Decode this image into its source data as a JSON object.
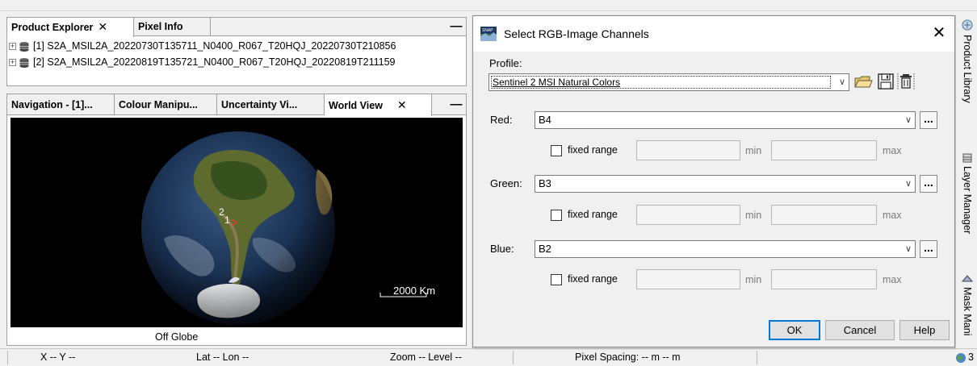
{
  "product_explorer": {
    "tabs": [
      {
        "label": "Product Explorer",
        "close": "✕"
      },
      {
        "label": "Pixel Info"
      }
    ],
    "minimize": "—",
    "products": [
      {
        "label": "[1] S2A_MSIL2A_20220730T135711_N0400_R067_T20HQJ_20220730T210856"
      },
      {
        "label": "[2] S2A_MSIL2A_20220819T135721_N0400_R067_T20HQJ_20220819T211159"
      }
    ]
  },
  "world_view_panel": {
    "tabs": [
      {
        "label": "Navigation - [1]..."
      },
      {
        "label": "Colour Manipu..."
      },
      {
        "label": "Uncertainty Vi..."
      },
      {
        "label": "World View",
        "close": "✕"
      }
    ],
    "minimize": "—",
    "markers": [
      "2",
      "1"
    ],
    "scale_label": "2000 Km",
    "off_globe": "Off Globe"
  },
  "status_bar": {
    "xy": "X   -- Y   --",
    "latlon": "Lat     -- Lon     --",
    "zoom": "Zoom -- Level --",
    "pixel_spacing": "Pixel Spacing: -- m -- m",
    "count": "3"
  },
  "dialog": {
    "title": "Select RGB-Image Channels",
    "close": "✕",
    "profile_label": "Profile:",
    "profile_value": "Sentinel 2 MSI Natural Colors",
    "channels": [
      {
        "label": "Red:",
        "value": "B4",
        "fixed_range": "fixed range",
        "min": "min",
        "max": "max"
      },
      {
        "label": "Green:",
        "value": "B3",
        "fixed_range": "fixed range",
        "min": "min",
        "max": "max"
      },
      {
        "label": "Blue:",
        "value": "B2",
        "fixed_range": "fixed range",
        "min": "min",
        "max": "max"
      }
    ],
    "dots": "...",
    "ok": "OK",
    "cancel": "Cancel",
    "help": "Help"
  },
  "right_tabs": [
    {
      "label": "Product Library"
    },
    {
      "label": "Layer Manager"
    },
    {
      "label": "Mask Mani"
    }
  ]
}
